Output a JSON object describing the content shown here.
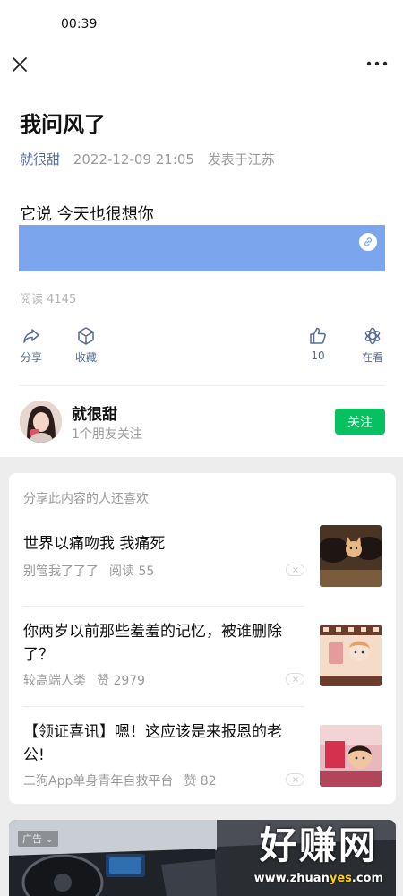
{
  "status_bar": {
    "time": "00:39"
  },
  "icons": {
    "close": "close-icon",
    "more": "more-icon",
    "link": "link-icon"
  },
  "article": {
    "title": "我问风了",
    "author": "就很甜",
    "date": "2022-12-09 21:05",
    "location": "发表于江苏",
    "body": "它说 今天也很想你",
    "reads": "阅读 4145"
  },
  "actions": {
    "share": "分享",
    "collect": "收藏",
    "like_count": "10",
    "watching": "在看"
  },
  "profile": {
    "name": "就很甜",
    "subtitle": "1个朋友关注",
    "follow_label": "关注"
  },
  "recommendations": {
    "title": "分享此内容的人还喜欢",
    "items": [
      {
        "title": "世界以痛吻我 我痛死",
        "source": "别管我了了了",
        "stat": "阅读 55"
      },
      {
        "title": "你两岁以前那些羞羞的记忆，被谁删除了？",
        "source": "较高端人类",
        "stat": "赞 2979"
      },
      {
        "title": "【领证喜讯】嗯！这应该是来报恩的老公!",
        "source": "二狗App单身青年自救平台",
        "stat": "赞 82"
      }
    ]
  },
  "ad": {
    "tag": "广告",
    "watermark_main": "好赚网",
    "watermark_url_a": "www.zhuan",
    "watermark_url_b": "yes",
    "watermark_url_c": ".com"
  },
  "colors": {
    "accent_link": "#576b95",
    "follow_green": "#07c160",
    "link_block": "#7ba6ee"
  }
}
